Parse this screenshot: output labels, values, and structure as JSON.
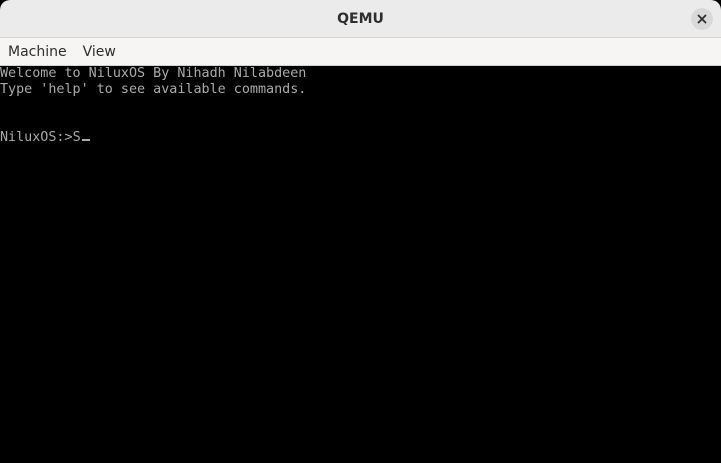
{
  "window": {
    "title": "QEMU",
    "close_icon": "close-icon"
  },
  "menubar": {
    "items": [
      {
        "label": "Machine"
      },
      {
        "label": "View"
      }
    ]
  },
  "console": {
    "lines": [
      "Welcome to NiluxOS By Nihadh Nilabdeen",
      "Type 'help' to see available commands."
    ],
    "prompt": "NiluxOS:>",
    "input": "S"
  },
  "colors": {
    "titlebar_bg": "#ebebeb",
    "menubar_bg": "#f6f5f4",
    "console_bg": "#000000",
    "console_text": "#aaaaaa"
  }
}
